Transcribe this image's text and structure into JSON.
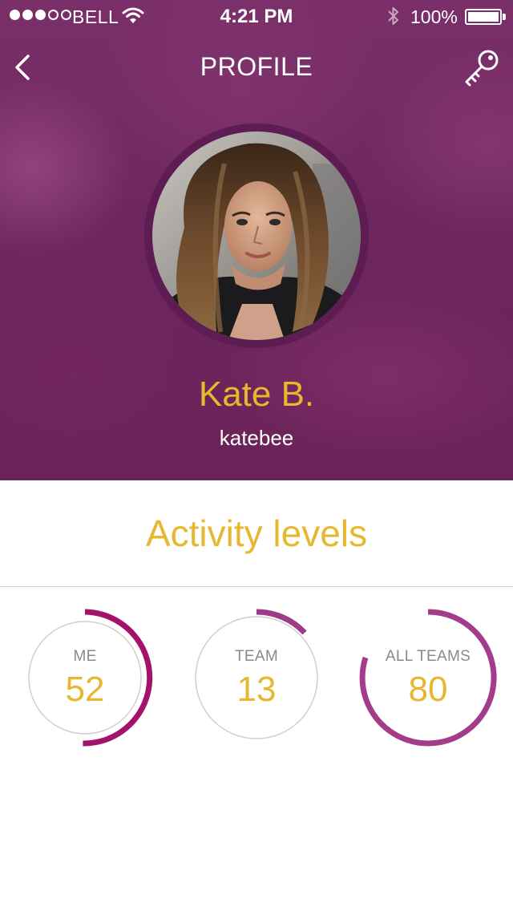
{
  "status_bar": {
    "carrier": "BELL",
    "signal_bars_filled": 3,
    "signal_bars_total": 5,
    "time": "4:21 PM",
    "battery_percent": "100%"
  },
  "nav": {
    "title": "PROFILE",
    "back_icon": "chevron-left-icon",
    "right_icon": "key-icon"
  },
  "profile": {
    "name": "Kate B.",
    "username": "katebee"
  },
  "activity": {
    "title": "Activity levels",
    "gauges": [
      {
        "label": "ME",
        "value": "52",
        "color": "#a4126c"
      },
      {
        "label": "TEAM",
        "value": "13",
        "color": "#9e3a86"
      },
      {
        "label": "ALL TEAMS",
        "value": "80",
        "color": "#a33d8b"
      }
    ]
  },
  "colors": {
    "accent_gold": "#e6b830",
    "header_purple": "#6e2660"
  }
}
